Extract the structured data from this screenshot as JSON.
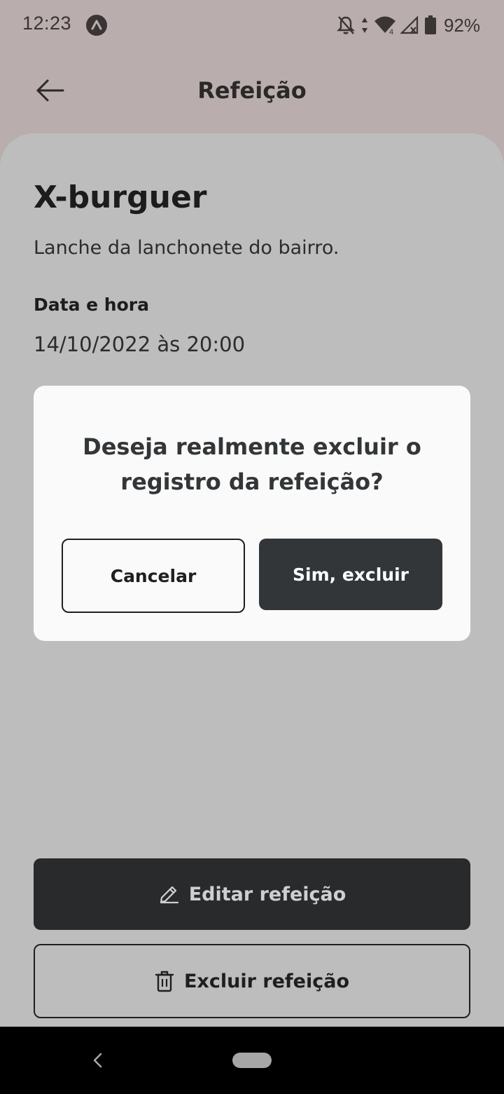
{
  "status_bar": {
    "time": "12:23",
    "battery": "92%"
  },
  "header": {
    "title": "Refeição"
  },
  "meal": {
    "name": "X-burguer",
    "description": "Lanche da lanchonete do bairro.",
    "datetime_label": "Data e hora",
    "datetime_value": "14/10/2022 às 20:00"
  },
  "actions": {
    "edit_label": "Editar refeição",
    "delete_label": "Excluir refeição"
  },
  "modal": {
    "message": "Deseja realmente excluir o registro da refeição?",
    "cancel_label": "Cancelar",
    "confirm_label": "Sim, excluir"
  },
  "colors": {
    "overlay_background": "#b9adad",
    "sheet_background": "#bdbdbd",
    "primary_dark": "#333638",
    "modal_background": "#fafafa"
  },
  "icons": {
    "back": "arrow-left-icon",
    "edit": "pencil-icon",
    "delete": "trash-icon",
    "app": "app-indicator-icon",
    "notifications_off": "bell-off-icon",
    "data": "data-transfer-icon",
    "wifi": "wifi-icon",
    "signal": "signal-icon",
    "battery": "battery-icon",
    "nav_back": "nav-back-icon",
    "nav_home": "home-pill-icon"
  }
}
